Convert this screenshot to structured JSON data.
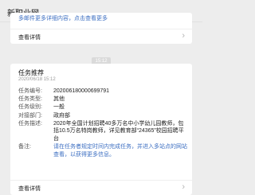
{
  "app": {
    "title": "新职业网"
  },
  "top_card": {
    "partial_note": "多邮件更多详细内容，点击查看更多",
    "more_label": "查看详情"
  },
  "timestamp": "15:12",
  "task": {
    "title": "任务推荐",
    "date": "2020/06/18 15:12",
    "fields": [
      {
        "label": "任务编号:",
        "value": "202006180000699791"
      },
      {
        "label": "任务类型:",
        "value": "其他"
      },
      {
        "label": "任务级别:",
        "value": "一般"
      },
      {
        "label": "对接部门:",
        "value": "政府部"
      },
      {
        "label": "任务描述:",
        "value": "2020年全国计划招聘40多万名中小学幼儿园教师，包括10.5万名特岗教师，详见教育部“24365”校园招聘平台"
      },
      {
        "label": "备注:",
        "value": "请在任务者规定时间内完成任务，并进入多站点的网站查看，以获得更多信息。"
      }
    ],
    "more_label": "查看详情"
  }
}
